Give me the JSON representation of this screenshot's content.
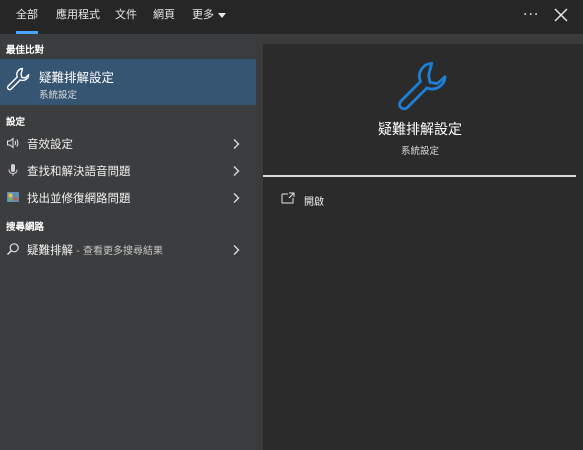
{
  "tabs": [
    {
      "label": "全部",
      "active": true
    },
    {
      "label": "應用程式",
      "active": false
    },
    {
      "label": "文件",
      "active": false
    },
    {
      "label": "網頁",
      "active": false
    },
    {
      "label": "更多",
      "active": false
    }
  ],
  "header": {
    "more_icon": "ellipsis-icon",
    "close_icon": "close-icon"
  },
  "left": {
    "best_match_heading": "最佳比對",
    "best_match": {
      "title": "疑難排解設定",
      "subtitle": "系統設定",
      "icon": "wrench-icon"
    },
    "settings_heading": "設定",
    "settings_items": [
      {
        "label": "音效設定",
        "icon": "speaker-icon"
      },
      {
        "label": "查找和解決語音問題",
        "icon": "microphone-icon"
      },
      {
        "label": "找出並修復網路問題",
        "icon": "network-troubleshoot-icon"
      }
    ],
    "web_heading": "搜尋網路",
    "web_item": {
      "label": "疑難排解",
      "hint": " - 查看更多搜尋結果",
      "icon": "search-icon"
    }
  },
  "right": {
    "title": "疑難排解設定",
    "subtitle": "系統設定",
    "icon": "wrench-icon",
    "actions": [
      {
        "label": "開啟",
        "icon": "open-icon"
      }
    ]
  },
  "colors": {
    "accent": "#4aa3ff",
    "selected_bg": "#355572",
    "icon_blue": "#1e7fd6"
  }
}
